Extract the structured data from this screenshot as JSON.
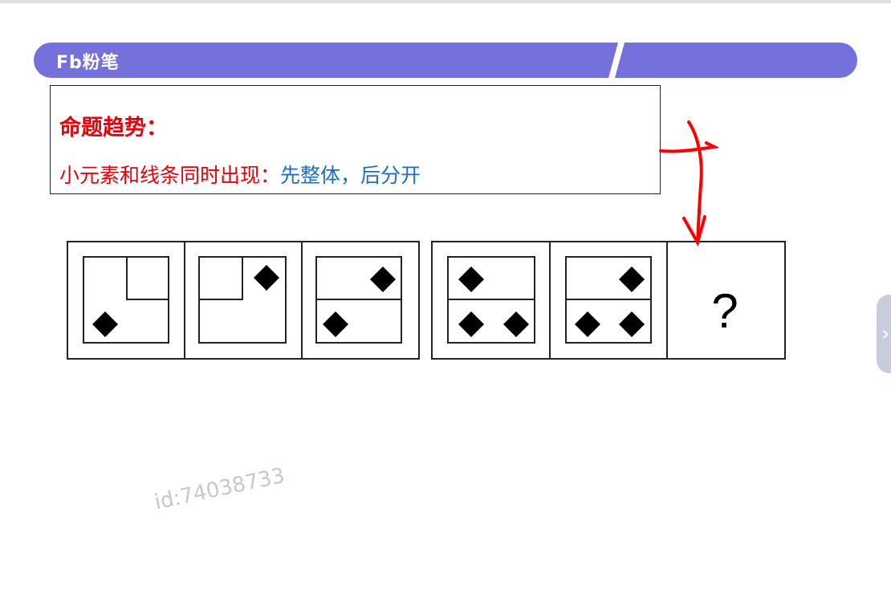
{
  "header": {
    "logo_text": "Fb粉笔",
    "brand_color": "#7571dc"
  },
  "note": {
    "title": "命题趋势：",
    "line_red": "小元素和线条同时出现：",
    "line_blue": "先整体，后分开"
  },
  "puzzle": {
    "group1": [
      {
        "panel": 1,
        "small_square": "top-right",
        "diamonds": 1
      },
      {
        "panel": 2,
        "small_square": "top-left",
        "diamonds": 1
      },
      {
        "panel": 3,
        "divider": "horizontal",
        "diamonds": 2
      }
    ],
    "group2": [
      {
        "panel": 4,
        "divider": "horizontal",
        "diamonds": 3
      },
      {
        "panel": 5,
        "divider": "horizontal",
        "diamonds": 3
      },
      {
        "panel": 6,
        "content": "?"
      }
    ],
    "question_mark": "?"
  },
  "annotation": {
    "color": "#ff0000",
    "shape": "hand-drawn arrow"
  },
  "watermark": "id:74038733",
  "side_button": {
    "icon": "chevron-right-icon"
  }
}
